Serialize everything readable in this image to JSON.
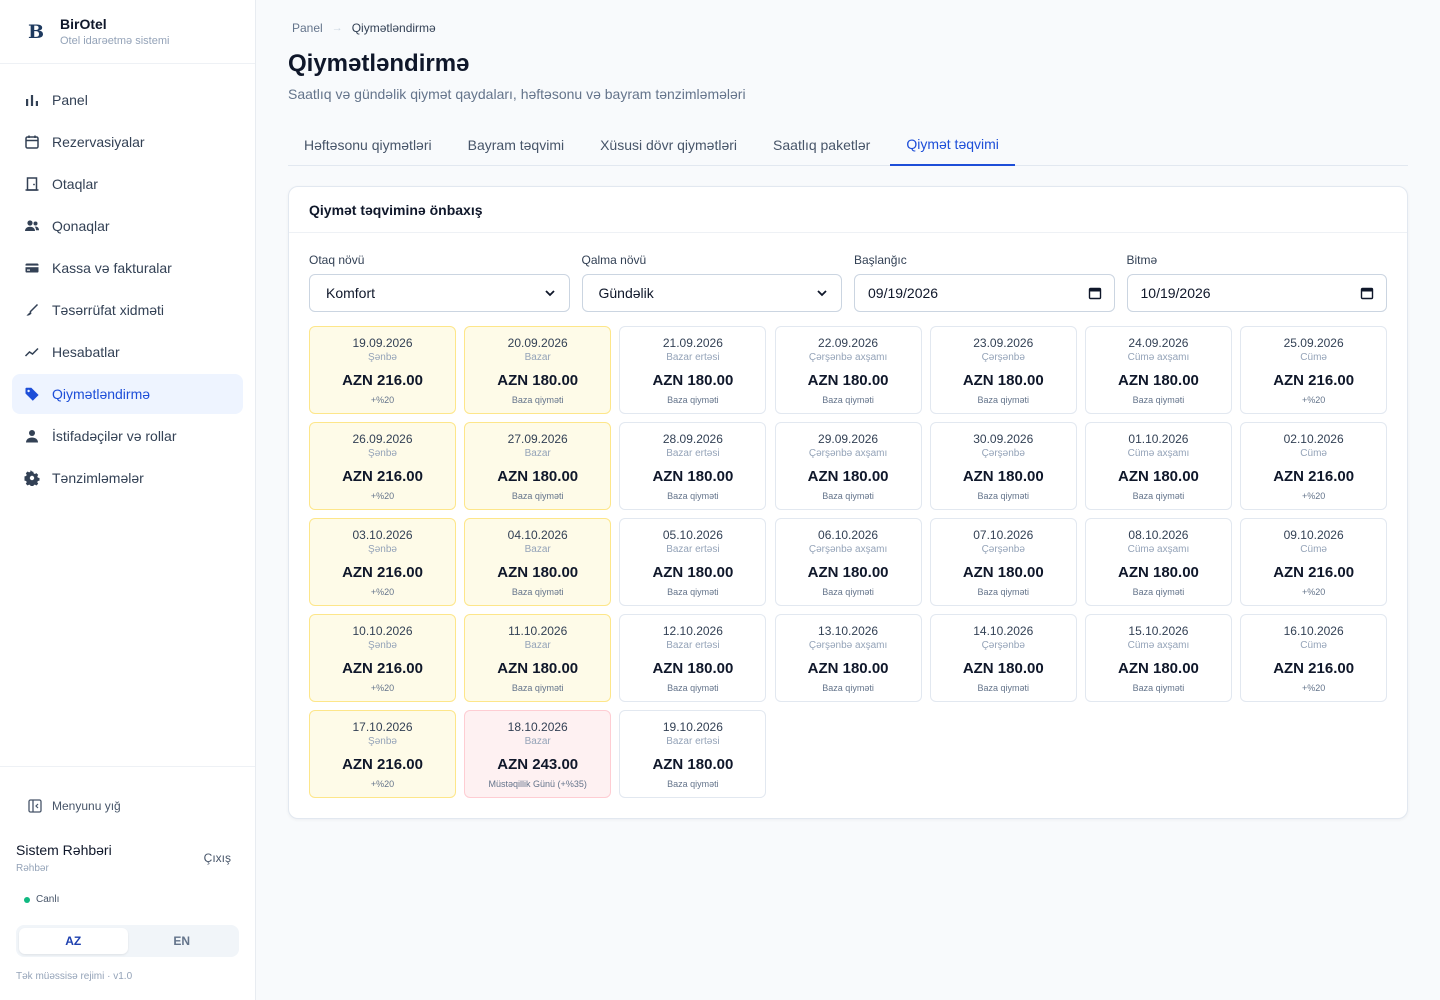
{
  "app": {
    "name": "BirOtel",
    "subtitle": "Otel idarəetmə sistemi",
    "logo_letter": "B"
  },
  "sidebar": {
    "items": [
      {
        "label": "Panel",
        "icon": "bar-chart-icon",
        "active": false
      },
      {
        "label": "Rezervasiyalar",
        "icon": "calendar-icon",
        "active": false
      },
      {
        "label": "Otaqlar",
        "icon": "door-icon",
        "active": false
      },
      {
        "label": "Qonaqlar",
        "icon": "users-icon",
        "active": false
      },
      {
        "label": "Kassa və fakturalar",
        "icon": "credit-card-icon",
        "active": false
      },
      {
        "label": "Təsərrüfat xidməti",
        "icon": "broom-icon",
        "active": false
      },
      {
        "label": "Hesabatlar",
        "icon": "trend-icon",
        "active": false
      },
      {
        "label": "Qiymətləndirmə",
        "icon": "tag-icon",
        "active": true
      },
      {
        "label": "İstifadəçilər və rollar",
        "icon": "user-icon",
        "active": false
      },
      {
        "label": "Tənzimləmələr",
        "icon": "gear-icon",
        "active": false
      }
    ],
    "collapse_label": "Menyunu yığ",
    "user_name": "Sistem Rəhbəri",
    "user_role": "Rəhbər",
    "logout_label": "Çıxış",
    "status_label": "Canlı",
    "languages": [
      "AZ",
      "EN"
    ],
    "active_language": "AZ",
    "footer": "Tək müəssisə rejimi · v1.0"
  },
  "breadcrumb": {
    "root": "Panel",
    "current": "Qiymətləndirmə"
  },
  "page": {
    "title": "Qiymətləndirmə",
    "subtitle": "Saatlıq və gündəlik qiymət qaydaları, həftəsonu və bayram tənzimləmələri"
  },
  "tabs": [
    {
      "label": "Həftəsonu qiymətləri",
      "active": false
    },
    {
      "label": "Bayram təqvimi",
      "active": false
    },
    {
      "label": "Xüsusi dövr qiymətləri",
      "active": false
    },
    {
      "label": "Saatlıq paketlər",
      "active": false
    },
    {
      "label": "Qiymət təqvimi",
      "active": true
    }
  ],
  "card": {
    "title": "Qiymət təqviminə önbaxış"
  },
  "filters": {
    "room_type": {
      "label": "Otaq növü",
      "value": "Komfort"
    },
    "stay_type": {
      "label": "Qalma növü",
      "value": "Gündəlik"
    },
    "start": {
      "label": "Başlanğıc",
      "value": "09/19/2026"
    },
    "end": {
      "label": "Bitmə",
      "value": "10/19/2026"
    }
  },
  "colors": {
    "accent": "#1d4ed8",
    "weekend_bg": "#fefbe8",
    "weekend_border": "#fde68a",
    "holiday_bg": "#fef1f2",
    "holiday_border": "#fecdd3"
  },
  "calendar": [
    {
      "date": "19.09.2026",
      "weekday": "Şənbə",
      "price": "AZN 216.00",
      "note": "+%20",
      "kind": "weekend"
    },
    {
      "date": "20.09.2026",
      "weekday": "Bazar",
      "price": "AZN 180.00",
      "note": "Baza qiyməti",
      "kind": "weekend"
    },
    {
      "date": "21.09.2026",
      "weekday": "Bazar ertəsi",
      "price": "AZN 180.00",
      "note": "Baza qiyməti",
      "kind": "normal"
    },
    {
      "date": "22.09.2026",
      "weekday": "Çərşənbə axşamı",
      "price": "AZN 180.00",
      "note": "Baza qiyməti",
      "kind": "normal"
    },
    {
      "date": "23.09.2026",
      "weekday": "Çərşənbə",
      "price": "AZN 180.00",
      "note": "Baza qiyməti",
      "kind": "normal"
    },
    {
      "date": "24.09.2026",
      "weekday": "Cümə axşamı",
      "price": "AZN 180.00",
      "note": "Baza qiyməti",
      "kind": "normal"
    },
    {
      "date": "25.09.2026",
      "weekday": "Cümə",
      "price": "AZN 216.00",
      "note": "+%20",
      "kind": "normal"
    },
    {
      "date": "26.09.2026",
      "weekday": "Şənbə",
      "price": "AZN 216.00",
      "note": "+%20",
      "kind": "weekend"
    },
    {
      "date": "27.09.2026",
      "weekday": "Bazar",
      "price": "AZN 180.00",
      "note": "Baza qiyməti",
      "kind": "weekend"
    },
    {
      "date": "28.09.2026",
      "weekday": "Bazar ertəsi",
      "price": "AZN 180.00",
      "note": "Baza qiyməti",
      "kind": "normal"
    },
    {
      "date": "29.09.2026",
      "weekday": "Çərşənbə axşamı",
      "price": "AZN 180.00",
      "note": "Baza qiyməti",
      "kind": "normal"
    },
    {
      "date": "30.09.2026",
      "weekday": "Çərşənbə",
      "price": "AZN 180.00",
      "note": "Baza qiyməti",
      "kind": "normal"
    },
    {
      "date": "01.10.2026",
      "weekday": "Cümə axşamı",
      "price": "AZN 180.00",
      "note": "Baza qiyməti",
      "kind": "normal"
    },
    {
      "date": "02.10.2026",
      "weekday": "Cümə",
      "price": "AZN 216.00",
      "note": "+%20",
      "kind": "normal"
    },
    {
      "date": "03.10.2026",
      "weekday": "Şənbə",
      "price": "AZN 216.00",
      "note": "+%20",
      "kind": "weekend"
    },
    {
      "date": "04.10.2026",
      "weekday": "Bazar",
      "price": "AZN 180.00",
      "note": "Baza qiyməti",
      "kind": "weekend"
    },
    {
      "date": "05.10.2026",
      "weekday": "Bazar ertəsi",
      "price": "AZN 180.00",
      "note": "Baza qiyməti",
      "kind": "normal"
    },
    {
      "date": "06.10.2026",
      "weekday": "Çərşənbə axşamı",
      "price": "AZN 180.00",
      "note": "Baza qiyməti",
      "kind": "normal"
    },
    {
      "date": "07.10.2026",
      "weekday": "Çərşənbə",
      "price": "AZN 180.00",
      "note": "Baza qiyməti",
      "kind": "normal"
    },
    {
      "date": "08.10.2026",
      "weekday": "Cümə axşamı",
      "price": "AZN 180.00",
      "note": "Baza qiyməti",
      "kind": "normal"
    },
    {
      "date": "09.10.2026",
      "weekday": "Cümə",
      "price": "AZN 216.00",
      "note": "+%20",
      "kind": "normal"
    },
    {
      "date": "10.10.2026",
      "weekday": "Şənbə",
      "price": "AZN 216.00",
      "note": "+%20",
      "kind": "weekend"
    },
    {
      "date": "11.10.2026",
      "weekday": "Bazar",
      "price": "AZN 180.00",
      "note": "Baza qiyməti",
      "kind": "weekend"
    },
    {
      "date": "12.10.2026",
      "weekday": "Bazar ertəsi",
      "price": "AZN 180.00",
      "note": "Baza qiyməti",
      "kind": "normal"
    },
    {
      "date": "13.10.2026",
      "weekday": "Çərşənbə axşamı",
      "price": "AZN 180.00",
      "note": "Baza qiyməti",
      "kind": "normal"
    },
    {
      "date": "14.10.2026",
      "weekday": "Çərşənbə",
      "price": "AZN 180.00",
      "note": "Baza qiyməti",
      "kind": "normal"
    },
    {
      "date": "15.10.2026",
      "weekday": "Cümə axşamı",
      "price": "AZN 180.00",
      "note": "Baza qiyməti",
      "kind": "normal"
    },
    {
      "date": "16.10.2026",
      "weekday": "Cümə",
      "price": "AZN 216.00",
      "note": "+%20",
      "kind": "normal"
    },
    {
      "date": "17.10.2026",
      "weekday": "Şənbə",
      "price": "AZN 216.00",
      "note": "+%20",
      "kind": "weekend"
    },
    {
      "date": "18.10.2026",
      "weekday": "Bazar",
      "price": "AZN 243.00",
      "note": "Müstəqillik Günü (+%35)",
      "kind": "holiday"
    },
    {
      "date": "19.10.2026",
      "weekday": "Bazar ertəsi",
      "price": "AZN 180.00",
      "note": "Baza qiyməti",
      "kind": "normal"
    }
  ]
}
